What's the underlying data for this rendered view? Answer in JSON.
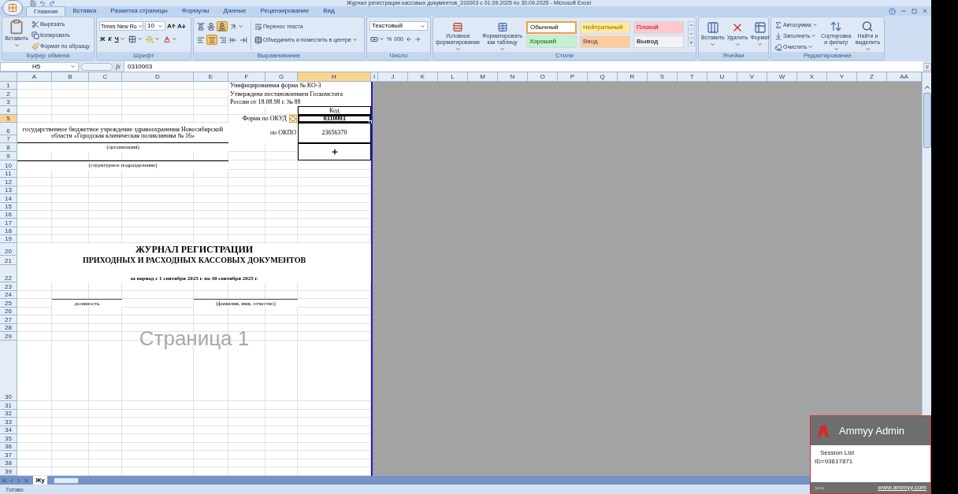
{
  "window": {
    "title": "Журнал регистрации кассовых документов_310003 с 01.09.2025 по 30.09.2025 - Microsoft Excel"
  },
  "ribbon_tabs": [
    {
      "label": "Главная",
      "selected": true
    },
    {
      "label": "Вставка",
      "selected": false
    },
    {
      "label": "Разметка страницы",
      "selected": false
    },
    {
      "label": "Формулы",
      "selected": false
    },
    {
      "label": "Данные",
      "selected": false
    },
    {
      "label": "Рецензирование",
      "selected": false
    },
    {
      "label": "Вид",
      "selected": false
    }
  ],
  "ribbon": {
    "clipboard": {
      "label": "Буфер обмена",
      "paste": "Вставить",
      "cut": "Вырезать",
      "copy": "Копировать",
      "format_painter": "Формат по образцу"
    },
    "font": {
      "label": "Шрифт",
      "font_name": "Times New Ro",
      "font_size": "10",
      "bold": "Ж",
      "italic": "К",
      "underline": "Ч"
    },
    "alignment": {
      "label": "Выравнивание",
      "vertical": [
        {
          "kind": "top",
          "selected": false
        },
        {
          "kind": "middle",
          "selected": false
        },
        {
          "kind": "bottom",
          "selected": true
        }
      ],
      "horizontal": [
        {
          "kind": "left",
          "selected": false
        },
        {
          "kind": "center",
          "selected": true
        },
        {
          "kind": "right",
          "selected": false
        }
      ],
      "wrap_text": "Перенос текста",
      "merge_center": "Объединить и поместить в центре"
    },
    "number": {
      "label": "Число",
      "format": "Текстовый",
      "percent": "%",
      "thousands": "000"
    },
    "styles": {
      "label": "Стили",
      "conditional_formatting": "Условное форматирование",
      "format_as_table": "Форматировать как таблицу",
      "gallery": [
        {
          "kind": "normal",
          "label": "Обычный",
          "selected": true
        },
        {
          "kind": "neutral",
          "label": "Нейтральный",
          "selected": false
        },
        {
          "kind": "bad",
          "label": "Плохой",
          "selected": false
        },
        {
          "kind": "good",
          "label": "Хороший",
          "selected": false
        },
        {
          "kind": "input",
          "label": "Ввод",
          "selected": false
        },
        {
          "kind": "output",
          "label": "Вывод",
          "selected": false
        }
      ]
    },
    "cells": {
      "label": "Ячейки",
      "insert": "Вставить",
      "delete": "Удалить",
      "format": "Формат"
    },
    "editing": {
      "label": "Редактирование",
      "autosum": "Автосумма",
      "fill": "Заполнить",
      "clear": "Очистить",
      "sort_filter": "Сортировка и фильтр",
      "find_select": "Найти и выделить"
    }
  },
  "formula_bar": {
    "name_box": "H5",
    "fx": "fx",
    "value": "0310003"
  },
  "columns": [
    {
      "label": "A",
      "selected": false
    },
    {
      "label": "B",
      "selected": false
    },
    {
      "label": "C",
      "selected": false
    },
    {
      "label": "D",
      "selected": false
    },
    {
      "label": "E",
      "selected": false
    },
    {
      "label": "F",
      "selected": false
    },
    {
      "label": "G",
      "selected": false
    },
    {
      "label": "H",
      "selected": true
    },
    {
      "label": "I",
      "selected": false
    },
    {
      "label": "J",
      "selected": false
    },
    {
      "label": "K",
      "selected": false
    },
    {
      "label": "L",
      "selected": false
    },
    {
      "label": "M",
      "selected": false
    },
    {
      "label": "N",
      "selected": false
    },
    {
      "label": "O",
      "selected": false
    },
    {
      "label": "P",
      "selected": false
    },
    {
      "label": "Q",
      "selected": false
    },
    {
      "label": "R",
      "selected": false
    },
    {
      "label": "S",
      "selected": false
    },
    {
      "label": "T",
      "selected": false
    },
    {
      "label": "U",
      "selected": false
    },
    {
      "label": "V",
      "selected": false
    },
    {
      "label": "W",
      "selected": false
    },
    {
      "label": "X",
      "selected": false
    },
    {
      "label": "Y",
      "selected": false
    },
    {
      "label": "Z",
      "selected": false
    },
    {
      "label": "AA",
      "selected": false
    }
  ],
  "rows": [
    {
      "label": "1",
      "selected": false
    },
    {
      "label": "2",
      "selected": false
    },
    {
      "label": "3",
      "selected": false
    },
    {
      "label": "4",
      "selected": false
    },
    {
      "label": "5",
      "selected": true
    },
    {
      "label": "6",
      "selected": false
    },
    {
      "label": "7",
      "selected": false
    },
    {
      "label": "8",
      "selected": false
    },
    {
      "label": "9",
      "selected": false
    },
    {
      "label": "10",
      "selected": false
    },
    {
      "label": "11",
      "selected": false
    },
    {
      "label": "12",
      "selected": false
    },
    {
      "label": "13",
      "selected": false
    },
    {
      "label": "14",
      "selected": false
    },
    {
      "label": "15",
      "selected": false
    },
    {
      "label": "16",
      "selected": false
    },
    {
      "label": "17",
      "selected": false
    },
    {
      "label": "18",
      "selected": false
    },
    {
      "label": "19",
      "selected": false
    },
    {
      "label": "20",
      "selected": false
    },
    {
      "label": "21",
      "selected": false
    },
    {
      "label": "22",
      "selected": false
    },
    {
      "label": "23",
      "selected": false
    },
    {
      "label": "24",
      "selected": false
    },
    {
      "label": "25",
      "selected": false
    },
    {
      "label": "26",
      "selected": false
    },
    {
      "label": "27",
      "selected": false
    },
    {
      "label": "28",
      "selected": false
    },
    {
      "label": "29",
      "selected": false
    },
    {
      "label": "30",
      "selected": false
    },
    {
      "label": "31",
      "selected": false
    },
    {
      "label": "32",
      "selected": false
    },
    {
      "label": "33",
      "selected": false
    },
    {
      "label": "34",
      "selected": false
    },
    {
      "label": "35",
      "selected": false
    },
    {
      "label": "36",
      "selected": false
    },
    {
      "label": "37",
      "selected": false
    },
    {
      "label": "38",
      "selected": false
    },
    {
      "label": "39",
      "selected": false
    }
  ],
  "cells": [
    {
      "text": "Унифицированная форма № КО-3",
      "selected": false
    },
    {
      "text": "Утверждена постановлением Госкомстата",
      "selected": false
    },
    {
      "text": "России от 18.08.98 г. № 88",
      "selected": false
    },
    {
      "text": "Код",
      "selected": false
    },
    {
      "text": "Форма по ОКУД",
      "selected": false
    },
    {
      "text": "0310003",
      "selected": true
    },
    {
      "text": "государственное бюджетное учреждение здравоохранения Новосибирской области «Городская клиническая поликлиника № 16»",
      "selected": false
    },
    {
      "text": "по ОКПО",
      "selected": false
    },
    {
      "text": "23656370",
      "selected": false
    },
    {
      "text": "(организация)",
      "selected": false
    },
    {
      "text": "(структурное подразделение)",
      "selected": false
    },
    {
      "text": "ЖУРНАЛ  РЕГИСТРАЦИИ",
      "selected": false
    },
    {
      "text": "ПРИХОДНЫХ И РАСХОДНЫХ КАССОВЫХ  ДОКУМЕНТОВ",
      "selected": false
    },
    {
      "text": "за период с  1 сентября 2025 г. по 30 сентября 2025 г.",
      "selected": false
    },
    {
      "text": "должность",
      "selected": false
    },
    {
      "text": "(фамилия, имя, отчество)",
      "selected": false
    }
  ],
  "page_label": "Страница 1",
  "sheet_tabs": [
    {
      "label": "Жу",
      "selected": true
    }
  ],
  "status_bar": {
    "text": "Готово"
  },
  "ammyy": {
    "title": "Ammyy Admin",
    "session_list": "Session List",
    "id": "ID=93617871",
    "expand": ">>>",
    "link": "www.ammyy.com"
  }
}
